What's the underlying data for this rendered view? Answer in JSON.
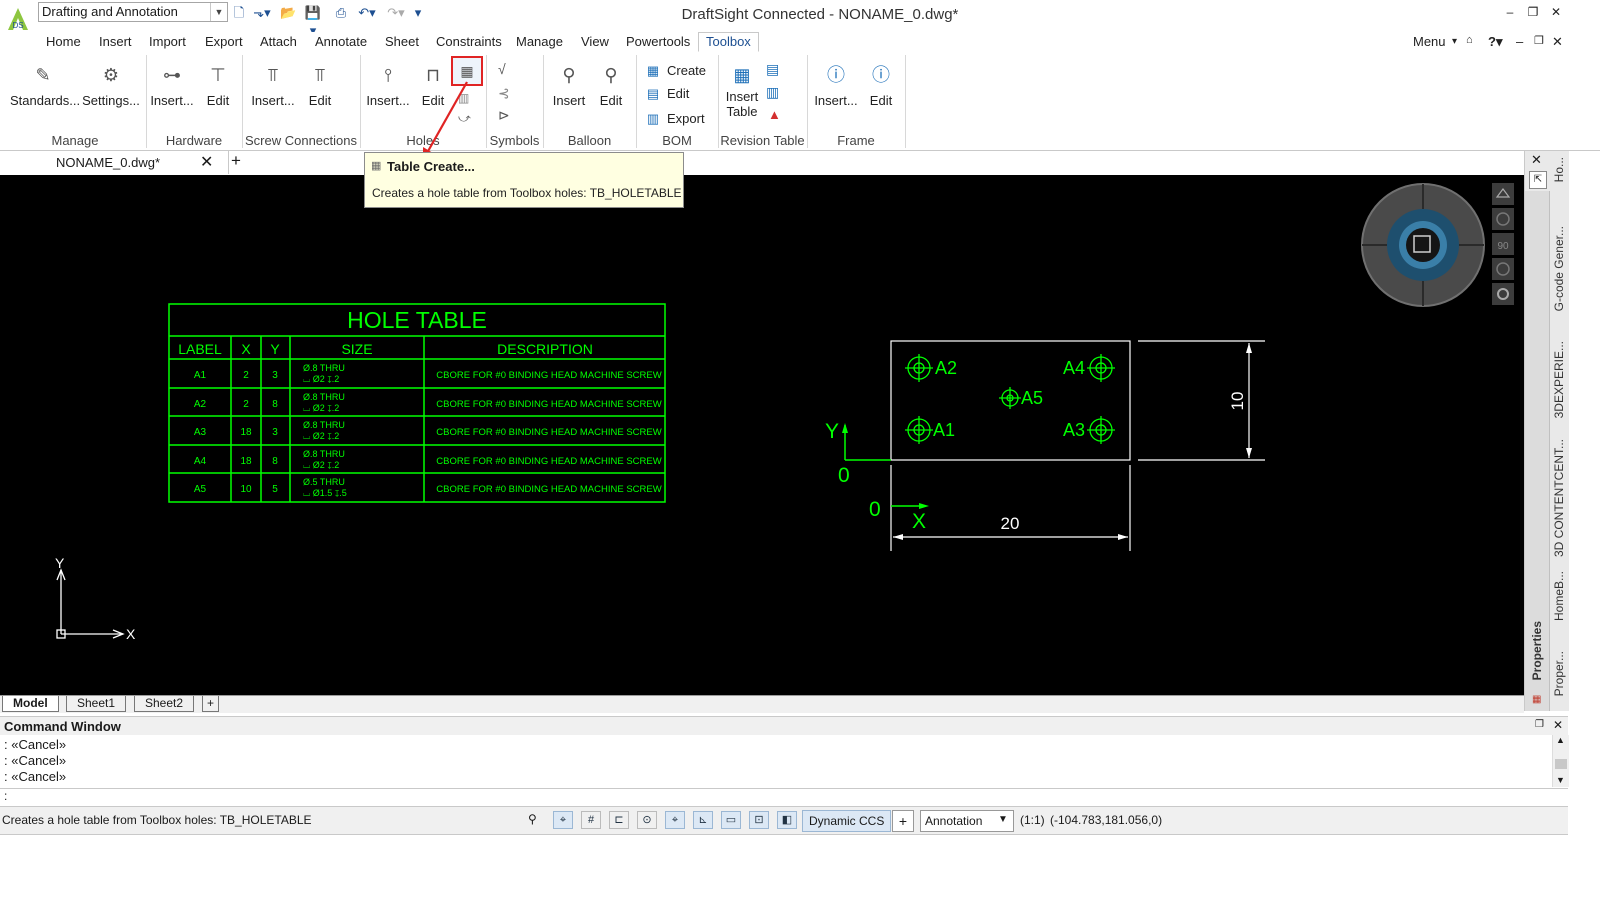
{
  "titlebar": {
    "workspace": "Drafting and Annotation",
    "title": "DraftSight Connected - NONAME_0.dwg*",
    "menu_label": "Menu"
  },
  "menu_tabs": [
    "Home",
    "Insert",
    "Import",
    "Export",
    "Attach",
    "Annotate",
    "Sheet",
    "Constraints",
    "Manage",
    "View",
    "Powertools",
    "Toolbox"
  ],
  "ribbon": {
    "manage": {
      "label": "Manage",
      "standards": "Standards...",
      "settings": "Settings..."
    },
    "hardware": {
      "label": "Hardware",
      "insert": "Insert...",
      "edit": "Edit"
    },
    "screw": {
      "label": "Screw Connections",
      "insert": "Insert...",
      "edit": "Edit"
    },
    "holes": {
      "label": "Holes",
      "insert": "Insert...",
      "edit": "Edit"
    },
    "symbols": {
      "label": "Symbols"
    },
    "balloon": {
      "label": "Balloon",
      "insert": "Insert",
      "edit": "Edit"
    },
    "bom": {
      "label": "BOM",
      "create": "Create",
      "edit": "Edit",
      "export": "Export"
    },
    "revision": {
      "label": "Revision Table",
      "insert_line1": "Insert",
      "insert_line2": "Table"
    },
    "frame": {
      "label": "Frame",
      "insert": "Insert...",
      "edit": "Edit"
    }
  },
  "document_tab": "NONAME_0.dwg*",
  "tooltip": {
    "title": "Table Create...",
    "description": "Creates a hole table from Toolbox holes: TB_HOLETABLE"
  },
  "hole_table": {
    "title": "HOLE TABLE",
    "headers": [
      "LABEL",
      "X",
      "Y",
      "SIZE",
      "DESCRIPTION"
    ],
    "rows": [
      {
        "label": "A1",
        "x": "2",
        "y": "3",
        "size1": "Ø.8 THRU",
        "size2": "⌴ Ø2 ↧.2",
        "desc": "CBORE FOR #0 BINDING HEAD MACHINE SCREW"
      },
      {
        "label": "A2",
        "x": "2",
        "y": "8",
        "size1": "Ø.8 THRU",
        "size2": "⌴ Ø2 ↧.2",
        "desc": "CBORE FOR #0 BINDING HEAD MACHINE SCREW"
      },
      {
        "label": "A3",
        "x": "18",
        "y": "3",
        "size1": "Ø.8 THRU",
        "size2": "⌴ Ø2 ↧.2",
        "desc": "CBORE FOR #0 BINDING HEAD MACHINE SCREW"
      },
      {
        "label": "A4",
        "x": "18",
        "y": "8",
        "size1": "Ø.8 THRU",
        "size2": "⌴ Ø2 ↧.2",
        "desc": "CBORE FOR #0 BINDING HEAD MACHINE SCREW"
      },
      {
        "label": "A5",
        "x": "10",
        "y": "5",
        "size1": "Ø.5 THRU",
        "size2": "⌴ Ø1.5 ↧.5",
        "desc": "CBORE FOR #0 BINDING HEAD MACHINE SCREW"
      }
    ]
  },
  "drawing": {
    "hole_labels": [
      "A1",
      "A2",
      "A3",
      "A4",
      "A5"
    ],
    "dim_width": "20",
    "dim_height": "10",
    "origin_y_label": "Y",
    "origin_x_label": "X",
    "origin_zero_1": "0",
    "origin_zero_2": "0"
  },
  "ucs": {
    "x": "X",
    "y": "Y"
  },
  "navbar": {
    "zoom_label": "90"
  },
  "side_tabs": [
    "Ho...",
    "G-code Gener...",
    "3DEXPERIE...",
    "3D CONTENTCENT...",
    "HomeB...",
    "Proper..."
  ],
  "properties_tab": "Properties",
  "sheet_tabs": [
    "Model",
    "Sheet1",
    "Sheet2"
  ],
  "command_window": {
    "title": "Command Window",
    "lines": [
      ": «Cancel»",
      ": «Cancel»",
      ": «Cancel»"
    ],
    "prompt": ":"
  },
  "statusbar": {
    "message": "Creates a hole table from Toolbox holes: TB_HOLETABLE",
    "ccs": "Dynamic CCS",
    "annotation": "Annotation",
    "scale": "(1:1)",
    "coords": "(-104.783,181.056,0)"
  },
  "colors": {
    "drawing_green": "#00ff00",
    "highlight_red": "#e02424",
    "canvas": "#000000"
  }
}
